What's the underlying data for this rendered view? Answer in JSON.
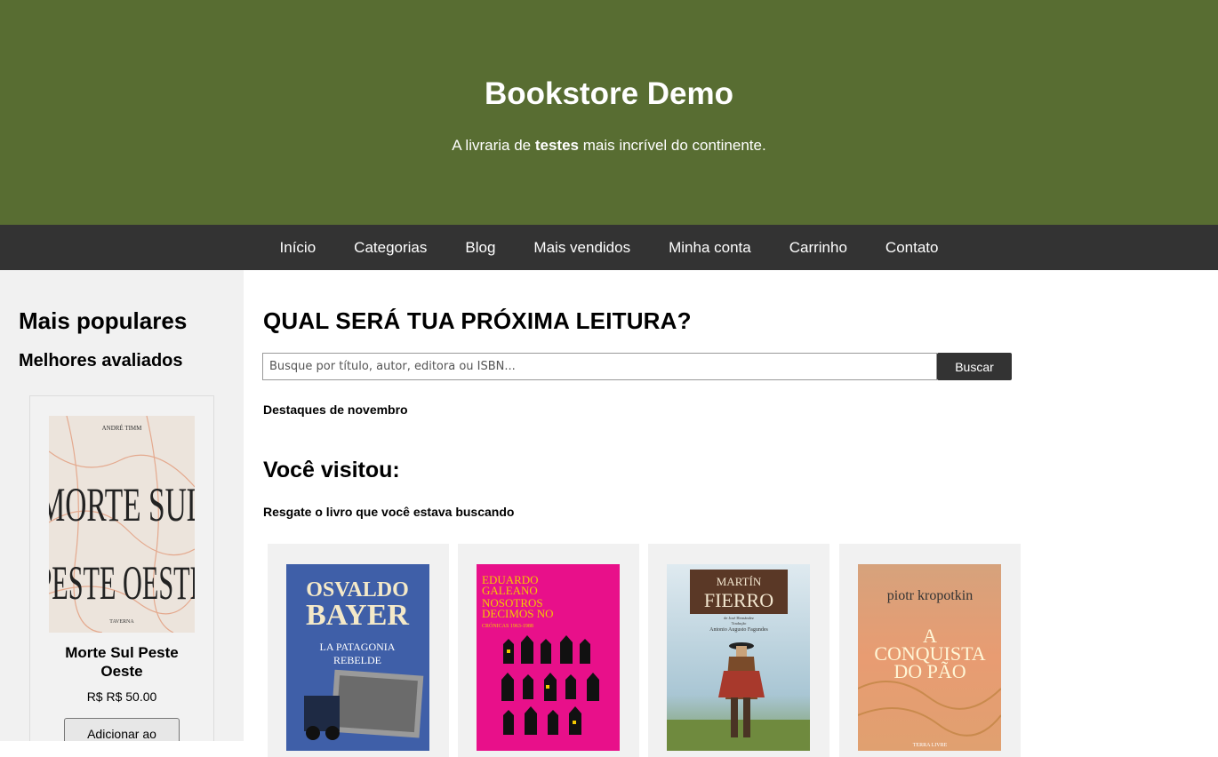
{
  "header": {
    "title": "Bookstore Demo",
    "tagline_before": "A livraria de ",
    "tagline_bold": "testes",
    "tagline_after": " mais incrível do continente."
  },
  "nav": {
    "items": [
      "Início",
      "Categorias",
      "Blog",
      "Mais vendidos",
      "Minha conta",
      "Carrinho",
      "Contato"
    ]
  },
  "sidebar": {
    "heading": "Mais populares",
    "subheading": "Melhores avaliados",
    "product": {
      "cover_author": "ANDRÉ TIMM",
      "cover_line1": "MORTE SUL",
      "cover_line2": "PESTE OESTE",
      "cover_publisher": "TAVERNA",
      "title": "Morte Sul Peste Oeste",
      "price": "R$ R$ 50.00",
      "button_label": "Adicionar ao Carrinho"
    }
  },
  "main": {
    "heading": "QUAL SERÁ TUA PRÓXIMA LEITURA?",
    "search_placeholder": "Busque por título, autor, editora ou ISBN...",
    "search_button": "Buscar",
    "highlights_label": "Destaques de novembro",
    "visited_heading": "Você visitou:",
    "visited_sub": "Resgate o livro que você estava buscando"
  },
  "visited_books": [
    {
      "cover_line1": "OSVALDO",
      "cover_line2": "BAYER",
      "cover_sub1": "LA PATAGONIA",
      "cover_sub2": "REBELDE",
      "color": "#3f5fa8"
    },
    {
      "cover_line1": "EDUARDO",
      "cover_line2": "GALEANO",
      "cover_sub1": "NOSOTROS",
      "cover_sub2": "DECIMOS NO",
      "cover_sub3": "CRÓNICAS 1963-1988",
      "color": "#e8108a"
    },
    {
      "cover_line1": "MARTÍN",
      "cover_line2": "FIERRO",
      "cover_sub1": "de José Hernández",
      "cover_sub2": "Tradução",
      "cover_sub3": "Antonio Augusto Fagundes",
      "color": "#b9d4e0"
    },
    {
      "cover_line1": "piotr kropotkin",
      "cover_sub1": "A",
      "cover_sub2": "CONQUISTA",
      "cover_sub3": "DO PÃO",
      "cover_footer": "TERRA LIVRE",
      "color": "#e79a78"
    }
  ],
  "colors": {
    "header_bg": "#586d32",
    "nav_bg": "#333333",
    "sidebar_bg": "#f1f1f1"
  }
}
